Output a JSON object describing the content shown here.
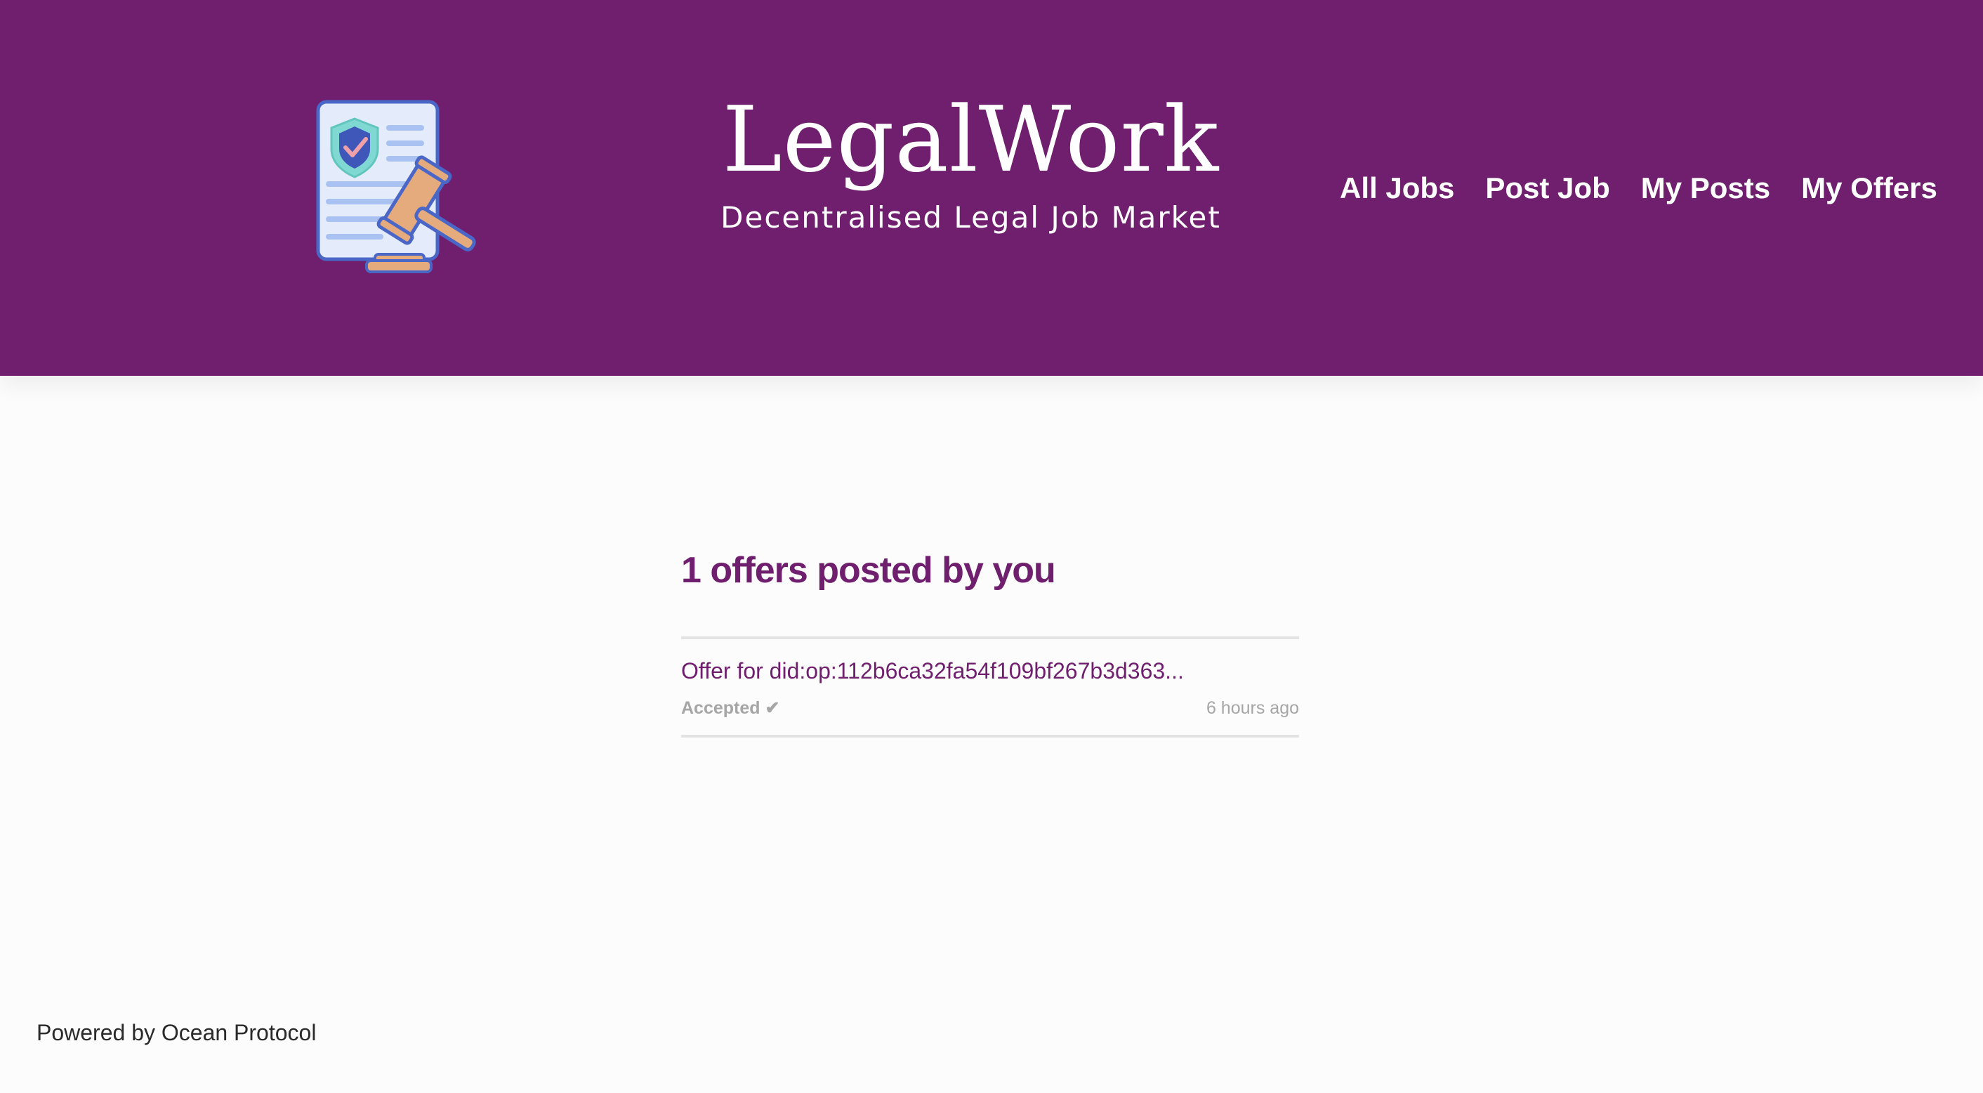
{
  "header": {
    "title": "LegalWork",
    "subtitle": "Decentralised Legal Job Market",
    "logo_icon": "legal-document-gavel-icon",
    "brand_color": "#6f1f6d",
    "nav": [
      {
        "label": "All Jobs"
      },
      {
        "label": "Post Job"
      },
      {
        "label": "My Posts"
      },
      {
        "label": "My Offers"
      }
    ]
  },
  "main": {
    "heading": "1 offers posted by you",
    "offers": [
      {
        "title": "Offer for did:op:112b6ca32fa54f109bf267b3d363...",
        "status": "Accepted",
        "status_icon": "check-icon",
        "status_glyph": "✔",
        "time": "6 hours ago"
      }
    ]
  },
  "footer": {
    "text": "Powered by Ocean Protocol"
  }
}
